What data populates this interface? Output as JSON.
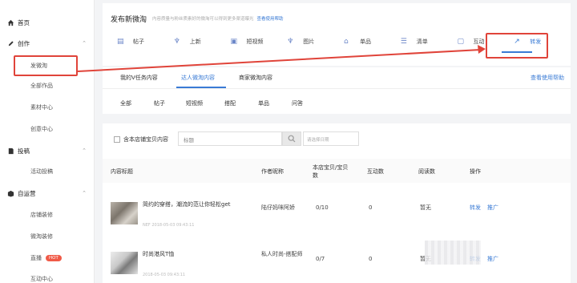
{
  "sidebar": {
    "home": "首页",
    "create": "创作",
    "create_items": [
      "发微淘",
      "全部作品",
      "素材中心",
      "创意中心"
    ],
    "deliver": "投稿",
    "deliver_items": [
      "活动投稿"
    ],
    "ops": "自运营",
    "ops_items": [
      "店铺装修",
      "微淘装修",
      "直播",
      "互动中心"
    ],
    "hot_badge": "HOT"
  },
  "header": {
    "title": "发布新微淘",
    "desc": "内容质量与粉丝质素好的微淘可以得到更多渠道曝光",
    "help_link": "查看使用帮助"
  },
  "types": [
    "帖子",
    "上新",
    "短视频",
    "图片",
    "单品",
    "清单",
    "互动",
    "转发"
  ],
  "tabs": [
    "我的V任务内容",
    "达人微淘内容",
    "商家微淘内容"
  ],
  "tabs_help": "查看使用帮助",
  "filters": [
    "全部",
    "帖子",
    "短视频",
    "搭配",
    "单品",
    "问答"
  ],
  "search": {
    "checkbox_label": "含本店铺宝贝内容",
    "placeholder": "标题",
    "date_placeholder": "请选择日期"
  },
  "table": {
    "headers": [
      "内容标题",
      "作者昵称",
      "本店宝贝/宝贝数",
      "互动数",
      "阅读数",
      "操作"
    ],
    "rows": [
      {
        "title": "简约的穿搭，潮流的范让你轻松get",
        "meta": "NEF 2018-05-03 09:43:11",
        "author": "陆仔妈咪阿娇",
        "ratio": "0/10",
        "interact": "0",
        "read": "暂无",
        "actions": [
          "转发",
          "推广"
        ]
      },
      {
        "title": "时尚港风T恤",
        "meta": "2018-05-03 09:43:11",
        "author": "私人时尚-搭配师",
        "ratio": "0/7",
        "interact": "0",
        "read": "暂无",
        "actions": [
          "转发",
          "推广"
        ]
      }
    ]
  },
  "colors": {
    "accent": "#3a7bd5",
    "highlight": "#e0443a"
  }
}
